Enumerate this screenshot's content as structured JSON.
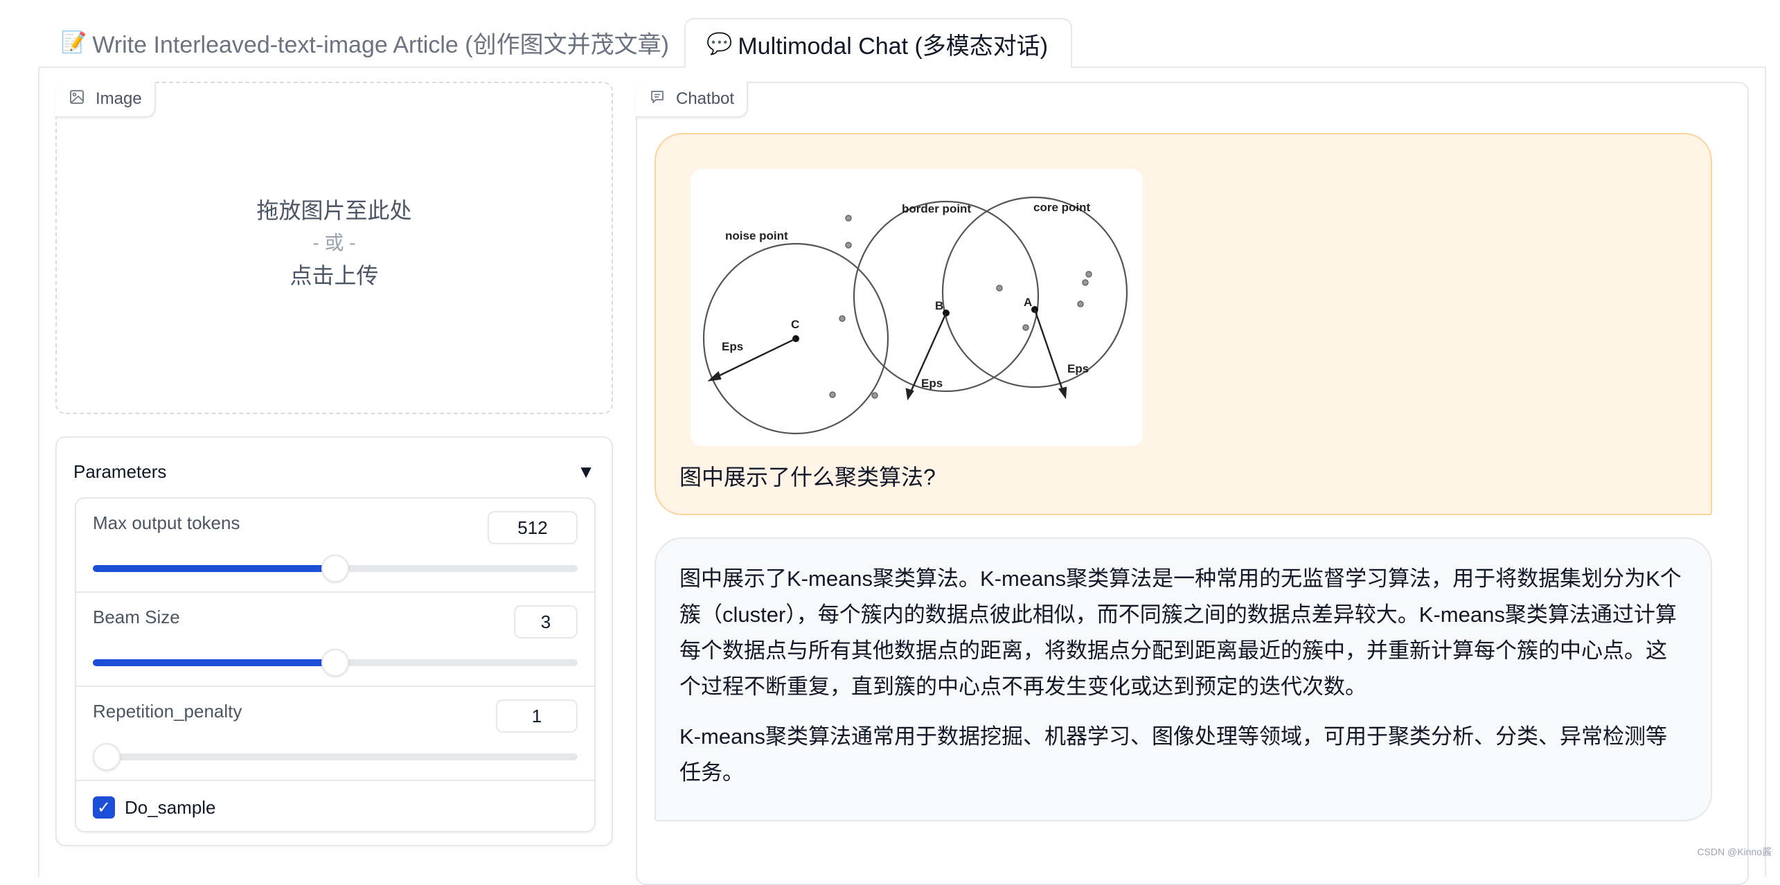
{
  "tabs": [
    {
      "label": "Write Interleaved-text-image Article (创作图文并茂文章)",
      "icon": "memo-pencil-icon",
      "icon_glyph": "📝",
      "active": false
    },
    {
      "label": "Multimodal Chat (多模态对话)",
      "icon": "speech-bubble-icon",
      "icon_glyph": "💬",
      "active": true
    }
  ],
  "image_upload": {
    "label": "Image",
    "drop_text": "拖放图片至此处",
    "or_text": "- 或 -",
    "click_text": "点击上传"
  },
  "parameters": {
    "title": "Parameters",
    "toggle_glyph": "▼",
    "max_output_tokens": {
      "label": "Max output tokens",
      "value": "512",
      "slider_fraction": 0.5
    },
    "beam_size": {
      "label": "Beam Size",
      "value": "3",
      "slider_fraction": 0.5
    },
    "repetition_penalty": {
      "label": "Repetition_penalty",
      "value": "1",
      "slider_fraction": 0.0
    },
    "do_sample": {
      "label": "Do_sample",
      "checked": true,
      "check_glyph": "✓"
    }
  },
  "chatbot": {
    "label": "Chatbot",
    "user_message": {
      "image": {
        "labels": {
          "noise": "noise point",
          "border": "border point",
          "core": "core point",
          "c": "C",
          "b": "B",
          "a": "A",
          "eps": "Eps"
        }
      },
      "text": "图中展示了什么聚类算法?"
    },
    "bot_message": {
      "paragraphs": [
        "图中展示了K-means聚类算法。K-means聚类算法是一种常用的无监督学习算法，用于将数据集划分为K个簇（cluster），每个簇内的数据点彼此相似，而不同簇之间的数据点差异较大。K-means聚类算法通过计算每个数据点与所有其他数据点的距离，将数据点分配到距离最近的簇中，并重新计算每个簇的中心点。这个过程不断重复，直到簇的中心点不再发生变化或达到预定的迭代次数。",
        "K-means聚类算法通常用于数据挖掘、机器学习、图像处理等领域，可用于聚类分析、分类、异常检测等任务。"
      ]
    }
  },
  "watermark": "CSDN @Kinno酱",
  "colors": {
    "accent": "#1d4ed8",
    "user_bubble_bg": "#fff4e6",
    "user_bubble_border": "#fcd49a",
    "bot_bubble_bg": "#f8f9fb",
    "border": "#e5e7eb"
  }
}
